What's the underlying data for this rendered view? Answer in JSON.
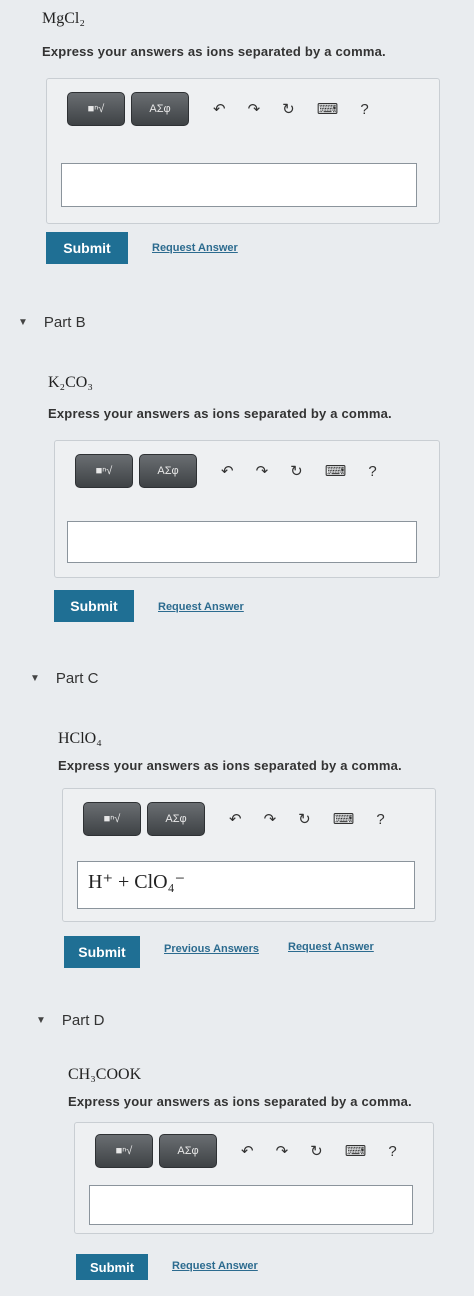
{
  "sections": [
    {
      "formula": "MgCl₂",
      "instruction": "Express your answers as ions separated by a comma.",
      "answer": "",
      "submit_label": "Submit",
      "links": [
        "Request Answer"
      ]
    },
    {
      "part_label": "Part B",
      "formula": "K₂CO₃",
      "instruction": "Express your answers as ions separated by a comma.",
      "answer": "",
      "submit_label": "Submit",
      "links": [
        "Request Answer"
      ]
    },
    {
      "part_label": "Part C",
      "formula": "HClO₄",
      "instruction": "Express your answers as ions separated by a comma.",
      "answer": "H⁺ + ClO₄⁻",
      "submit_label": "Submit",
      "links": [
        "Previous Answers",
        "Request Answer"
      ]
    },
    {
      "part_label": "Part D",
      "formula": "CH₃COOK",
      "instruction": "Express your answers as ions separated by a comma.",
      "answer": "",
      "submit_label": "Submit",
      "links": [
        "Request Answer"
      ]
    }
  ],
  "toolbar": {
    "template_button": "■ⁿ√",
    "symbols_button": "AΣφ",
    "undo_icon": "↶",
    "redo_icon": "↷",
    "reset_icon": "↻",
    "keyboard_icon": "⌨",
    "help_label": "?"
  }
}
